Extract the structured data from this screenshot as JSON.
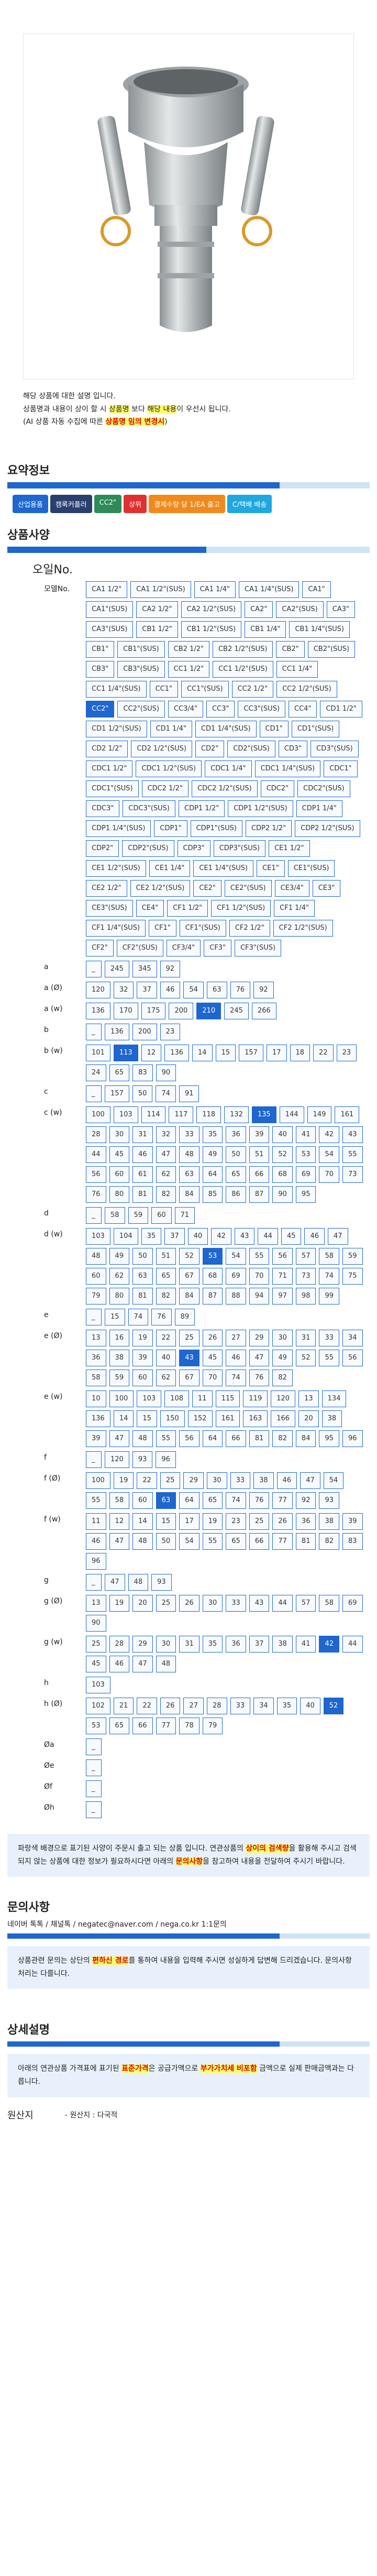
{
  "product": {
    "notice_lines": [
      [
        "해당 상품에 대한 설명 입니다."
      ],
      [
        "상품명과 내용이 상이 할 시 ",
        "상품명",
        " 보다 ",
        "해당 내용",
        "이 우선시 됩니다."
      ],
      [
        "(AI 상품 자동 수집에 따른 ",
        "상품명 임의 변경시",
        ")"
      ]
    ]
  },
  "summary": {
    "title": "요약정보",
    "tags": [
      {
        "label": "산업용품",
        "color": "#1e66d0"
      },
      {
        "label": "캠록커플러",
        "color": "#2a3f6e"
      },
      {
        "label": "CC2\"",
        "color": "#2e8b57"
      },
      {
        "label": "상위",
        "color": "#e03030"
      },
      {
        "label": "결제수량 당 1/EA 출고",
        "color": "#f08a1c"
      },
      {
        "label": "C/택배 배송",
        "color": "#1fa8e0"
      }
    ]
  },
  "options": {
    "title": "상품사양",
    "model_title": "오일No.",
    "rows": [
      {
        "label": "모델No.",
        "chips": [
          "CA1 1/2\"",
          "CA1 1/2\"(SUS)",
          "CA1 1/4\"",
          "CA1 1/4\"(SUS)",
          "CA1\"",
          "CA1\"(SUS)",
          "CA2 1/2\"",
          "CA2 1/2\"(SUS)",
          "CA2\"",
          "CA2\"(SUS)",
          "CA3\"",
          "CA3\"(SUS)",
          "CB1 1/2\"",
          "CB1 1/2\"(SUS)",
          "CB1 1/4\"",
          "CB1 1/4\"(SUS)",
          "CB1\"",
          "CB1\"(SUS)",
          "CB2 1/2\"",
          "CB2 1/2\"(SUS)",
          "CB2\"",
          "CB2\"(SUS)",
          "CB3\"",
          "CB3\"(SUS)",
          "CC1 1/2\"",
          "CC1 1/2\"(SUS)",
          "CC1 1/4\"",
          "CC1 1/4\"(SUS)",
          "CC1\"",
          "CC1\"(SUS)",
          "CC2 1/2\"",
          "CC2 1/2\"(SUS)",
          "CC2\"",
          "CC2\"(SUS)",
          "CC3/4\"",
          "CC3\"",
          "CC3\"(SUS)",
          "CC4\"",
          "CD1 1/2\"",
          "CD1 1/2\"(SUS)",
          "CD1 1/4\"",
          "CD1 1/4\"(SUS)",
          "CD1\"",
          "CD1\"(SUS)",
          "CD2 1/2\"",
          "CD2 1/2\"(SUS)",
          "CD2\"",
          "CD2\"(SUS)",
          "CD3\"",
          "CD3\"(SUS)",
          "CDC1 1/2\"",
          "CDC1 1/2\"(SUS)",
          "CDC1 1/4\"",
          "CDC1 1/4\"(SUS)",
          "CDC1\"",
          "CDC1\"(SUS)",
          "CDC2 1/2\"",
          "CDC2 1/2\"(SUS)",
          "CDC2\"",
          "CDC2\"(SUS)",
          "CDC3\"",
          "CDC3\"(SUS)",
          "CDP1 1/2\"",
          "CDP1 1/2\"(SUS)",
          "CDP1 1/4\"",
          "CDP1 1/4\"(SUS)",
          "CDP1\"",
          "CDP1\"(SUS)",
          "CDP2 1/2\"",
          "CDP2 1/2\"(SUS)",
          "CDP2\"",
          "CDP2\"(SUS)",
          "CDP3\"",
          "CDP3\"(SUS)",
          "CE1 1/2\"",
          "CE1 1/2\"(SUS)",
          "CE1 1/4\"",
          "CE1 1/4\"(SUS)",
          "CE1\"",
          "CE1\"(SUS)",
          "CE2 1/2\"",
          "CE2 1/2\"(SUS)",
          "CE2\"",
          "CE2\"(SUS)",
          "CE3/4\"",
          "CE3\"",
          "CE3\"(SUS)",
          "CE4\"",
          "CF1 1/2\"",
          "CF1 1/2\"(SUS)",
          "CF1 1/4\"",
          "CF1 1/4\"(SUS)",
          "CF1\"",
          "CF1\"(SUS)",
          "CF2 1/2\"",
          "CF2 1/2\"(SUS)",
          "CF2\"",
          "CF2\"(SUS)",
          "CF3/4\"",
          "CF3\"",
          "CF3\"(SUS)"
        ],
        "selected": "CC2\""
      },
      {
        "label": "a",
        "chips": [
          "_",
          "245",
          "345",
          "92"
        ]
      },
      {
        "label": "a (Ø)",
        "chips": [
          "120",
          "32",
          "37",
          "46",
          "54",
          "63",
          "76",
          "92"
        ]
      },
      {
        "label": "a (w)",
        "chips": [
          "136",
          "170",
          "175",
          "200",
          "210",
          "245",
          "266"
        ],
        "selected": "210"
      },
      {
        "label": "b",
        "chips": [
          "_",
          "136",
          "200",
          "23"
        ]
      },
      {
        "label": "b (w)",
        "chips": [
          "101",
          "113",
          "12",
          "136",
          "14",
          "15",
          "157",
          "17",
          "18",
          "22",
          "23",
          "24",
          "65",
          "83",
          "90"
        ],
        "selected": "113"
      },
      {
        "label": "c",
        "chips": [
          "_",
          "157",
          "50",
          "74",
          "91"
        ]
      },
      {
        "label": "c (w)",
        "chips": [
          "100",
          "103",
          "114",
          "117",
          "118",
          "132",
          "135",
          "144",
          "149",
          "161",
          "28",
          "30",
          "31",
          "32",
          "33",
          "35",
          "36",
          "39",
          "40",
          "41",
          "42",
          "43",
          "44",
          "45",
          "46",
          "47",
          "48",
          "49",
          "50",
          "51",
          "52",
          "53",
          "54",
          "55",
          "56",
          "60",
          "61",
          "62",
          "63",
          "64",
          "65",
          "66",
          "68",
          "69",
          "70",
          "73",
          "76",
          "80",
          "81",
          "82",
          "84",
          "85",
          "86",
          "87",
          "90",
          "95"
        ],
        "selected": "135"
      },
      {
        "label": "d",
        "chips": [
          "_",
          "58",
          "59",
          "60",
          "71"
        ]
      },
      {
        "label": "d (w)",
        "chips": [
          "103",
          "104",
          "35",
          "37",
          "40",
          "42",
          "43",
          "44",
          "45",
          "46",
          "47",
          "48",
          "49",
          "50",
          "51",
          "52",
          "53",
          "54",
          "55",
          "56",
          "57",
          "58",
          "59",
          "60",
          "62",
          "63",
          "65",
          "67",
          "68",
          "69",
          "70",
          "71",
          "73",
          "74",
          "75",
          "79",
          "80",
          "81",
          "82",
          "84",
          "87",
          "88",
          "94",
          "97",
          "98",
          "99"
        ],
        "selected": "53"
      },
      {
        "label": "e",
        "chips": [
          "_",
          "15",
          "74",
          "76",
          "89"
        ]
      },
      {
        "label": "e (Ø)",
        "chips": [
          "13",
          "16",
          "19",
          "22",
          "25",
          "26",
          "27",
          "29",
          "30",
          "31",
          "33",
          "34",
          "36",
          "38",
          "39",
          "40",
          "43",
          "45",
          "46",
          "47",
          "49",
          "52",
          "55",
          "56",
          "58",
          "59",
          "60",
          "62",
          "67",
          "70",
          "74",
          "76",
          "82"
        ],
        "selected": "43"
      },
      {
        "label": "e (w)",
        "chips": [
          "10",
          "100",
          "103",
          "108",
          "11",
          "115",
          "119",
          "120",
          "13",
          "134",
          "136",
          "14",
          "15",
          "150",
          "152",
          "161",
          "163",
          "166",
          "20",
          "38",
          "39",
          "47",
          "48",
          "55",
          "56",
          "64",
          "66",
          "81",
          "82",
          "84",
          "95",
          "96"
        ]
      },
      {
        "label": "f",
        "chips": [
          "_",
          "120",
          "93",
          "96"
        ]
      },
      {
        "label": "f (Ø)",
        "chips": [
          "100",
          "19",
          "22",
          "25",
          "29",
          "30",
          "33",
          "38",
          "46",
          "47",
          "54",
          "55",
          "58",
          "60",
          "63",
          "64",
          "65",
          "74",
          "76",
          "77",
          "92",
          "93"
        ],
        "selected": "63"
      },
      {
        "label": "f (w)",
        "chips": [
          "11",
          "12",
          "14",
          "15",
          "17",
          "19",
          "23",
          "25",
          "26",
          "36",
          "38",
          "39",
          "46",
          "47",
          "48",
          "50",
          "54",
          "55",
          "65",
          "66",
          "77",
          "81",
          "82",
          "83",
          "96"
        ]
      },
      {
        "label": "g",
        "chips": [
          "_",
          "47",
          "48",
          "93"
        ]
      },
      {
        "label": "g (Ø)",
        "chips": [
          "13",
          "19",
          "20",
          "25",
          "26",
          "30",
          "33",
          "43",
          "44",
          "57",
          "58",
          "69",
          "90"
        ]
      },
      {
        "label": "g (w)",
        "chips": [
          "25",
          "28",
          "29",
          "30",
          "31",
          "35",
          "36",
          "37",
          "38",
          "41",
          "42",
          "44",
          "45",
          "46",
          "47",
          "48"
        ],
        "selected": "42"
      },
      {
        "label": "h",
        "chips": [
          "103"
        ]
      },
      {
        "label": "h (Ø)",
        "chips": [
          "102",
          "21",
          "22",
          "26",
          "27",
          "28",
          "33",
          "34",
          "35",
          "40",
          "52",
          "53",
          "65",
          "66",
          "77",
          "78",
          "79"
        ],
        "selected": "52"
      },
      {
        "label": "Øa",
        "chips": [
          "_"
        ]
      },
      {
        "label": "Øe",
        "chips": [
          "_"
        ]
      },
      {
        "label": "Øf",
        "chips": [
          "_"
        ]
      },
      {
        "label": "Øh",
        "chips": [
          "_"
        ]
      }
    ],
    "guide_lines": [
      [
        "파랑색 배경으로 표기된 사양이 주문시 출고 되는 상품 입니다. 연관상품의 ",
        "상이의 검색량",
        "을 활용해 주시고 검색되지 않는 상품에 대한 정보가 필요하시다면 아래의 ",
        "문의사항",
        "을 참고하여 내용을 전달하여 주시기 바랍니다."
      ]
    ]
  },
  "inquiry": {
    "title": "문의사항",
    "contact": "네이버 톡톡 / 채널톡 / negatec@naver.com / nega.co.kr 1:1문의",
    "text": [
      "상품관련 문의는 상단의 ",
      "편하신 경로",
      "를 통하여 내용을 입력해 주시면 성실하게 답변해 드리겠습니다. 문의사항 처리는 다를니다."
    ]
  },
  "detail": {
    "title": "상세설명",
    "text": [
      "아래의 연관상품 가격표에 표기된 ",
      "표준가격",
      "은 공급가액으로 ",
      "부가가치세 비포함",
      " 금액으로 실제 판매금액과는 다릅니다."
    ],
    "origin_label": "원산지",
    "origin_value": "- 원산지 : 다국적"
  }
}
